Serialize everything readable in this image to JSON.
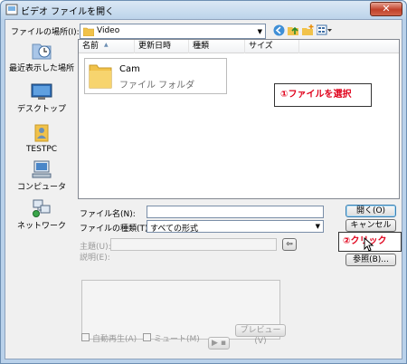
{
  "window": {
    "title": "ビデオ ファイルを開く",
    "close_glyph": "✕"
  },
  "location": {
    "label": "ファイルの場所(I):",
    "value": "Video"
  },
  "places": [
    {
      "label": "最近表示した場所",
      "icon": "recent-places-icon"
    },
    {
      "label": "デスクトップ",
      "icon": "desktop-icon"
    },
    {
      "label": "TESTPC",
      "icon": "user-folder-icon"
    },
    {
      "label": "コンピュータ",
      "icon": "computer-icon"
    },
    {
      "label": "ネットワーク",
      "icon": "network-icon"
    }
  ],
  "columns": [
    "名前",
    "更新日時",
    "種類",
    "サイズ"
  ],
  "items": [
    {
      "name": "Cam",
      "type": "ファイル フォルダ"
    }
  ],
  "annotations": {
    "step1": "①ファイルを選択",
    "step2": "②クリック"
  },
  "form": {
    "filename_label": "ファイル名(N):",
    "filename_value": "",
    "filetype_label": "ファイルの種類(T):",
    "filetype_value": "すべての形式",
    "title_label": "主題(U):",
    "desc_label": "説明(E):",
    "autoplay_label": "自動再生(A)",
    "mute_label": "ミュート(M)",
    "preview_label": "プレビュー(V)",
    "play_glyph": "▶ ▪"
  },
  "buttons": {
    "open": "開く(O)",
    "cancel": "キャンセル",
    "browse": "参照(B)..."
  },
  "colors": {
    "annotation": "#e0001a",
    "folder": "#f1c24a"
  }
}
